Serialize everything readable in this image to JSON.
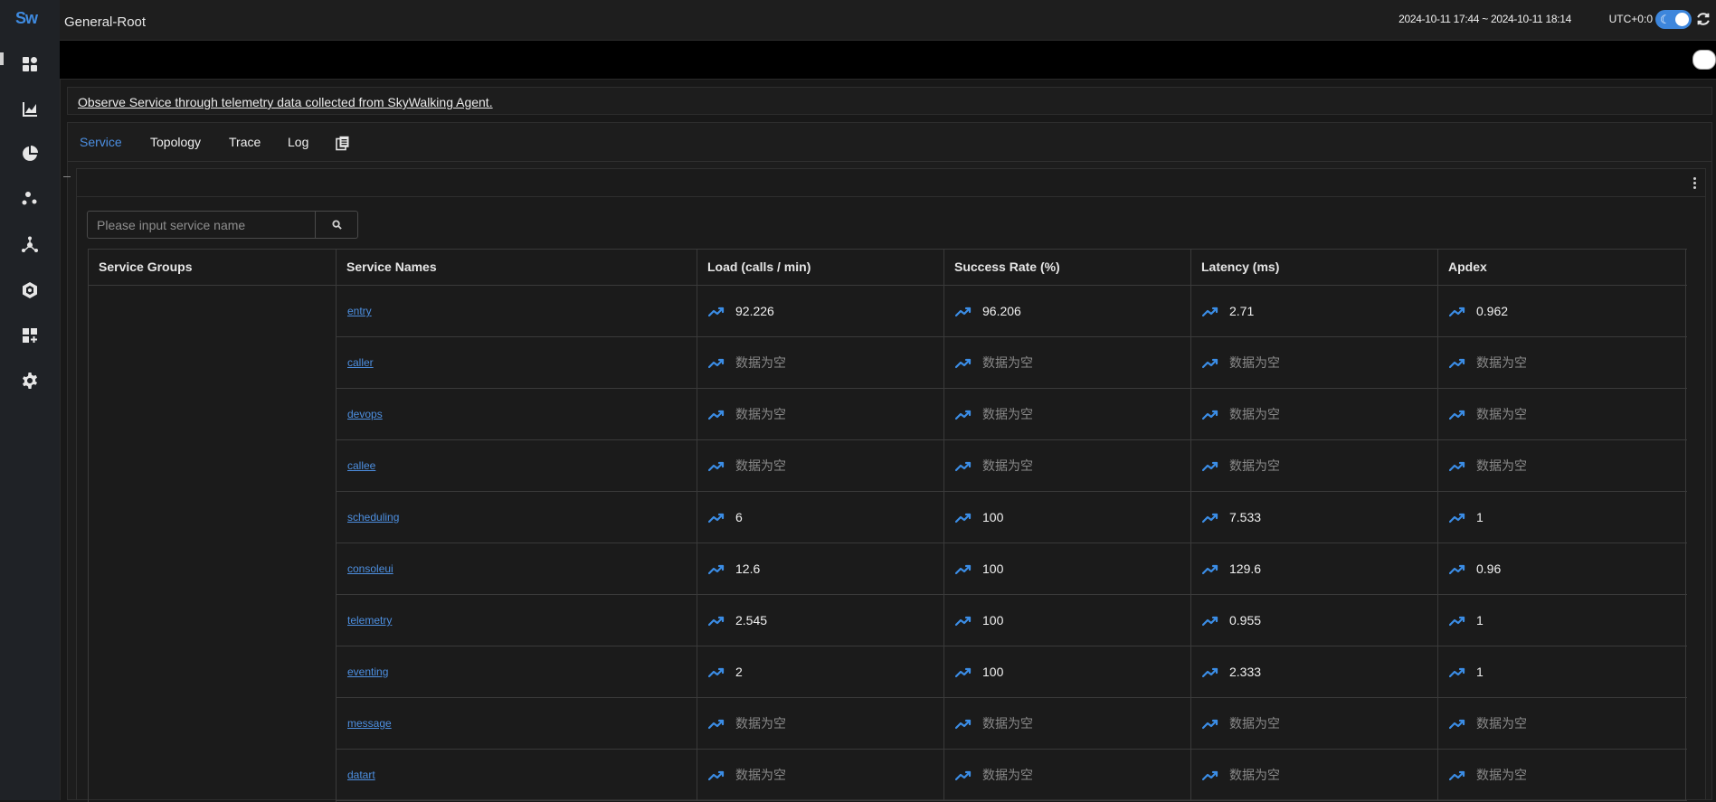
{
  "app": {
    "logo": "Sw",
    "page_title": "General-Root"
  },
  "topbar": {
    "time_range": "2024-10-11 17:44 ~ 2024-10-11 18:14",
    "timezone": "UTC+0:0",
    "theme_icon": "moon-icon",
    "refresh_icon": "refresh-icon"
  },
  "sidebar": {
    "items": [
      {
        "icon": "dashboard-grid-icon"
      },
      {
        "icon": "chart-icon"
      },
      {
        "icon": "pie-chart-icon"
      },
      {
        "icon": "dots-cluster-icon"
      },
      {
        "icon": "topology-icon"
      },
      {
        "icon": "hexagon-icon"
      },
      {
        "icon": "add-widget-icon"
      },
      {
        "icon": "settings-gear-icon"
      }
    ]
  },
  "description": "Observe Service through telemetry data collected from SkyWalking Agent.",
  "tabs": [
    {
      "label": "Service",
      "active": true
    },
    {
      "label": "Topology",
      "active": false
    },
    {
      "label": "Trace",
      "active": false
    },
    {
      "label": "Log",
      "active": false
    }
  ],
  "search": {
    "placeholder": "Please input service name"
  },
  "table": {
    "headers": [
      "Service Groups",
      "Service Names",
      "Load (calls / min)",
      "Success Rate (%)",
      "Latency (ms)",
      "Apdex"
    ],
    "empty_text": "数据为空",
    "rows": [
      {
        "name": "entry",
        "load": "92.226",
        "success": "96.206",
        "latency": "2.71",
        "apdex": "0.962"
      },
      {
        "name": "caller",
        "load": "数据为空",
        "success": "数据为空",
        "latency": "数据为空",
        "apdex": "数据为空"
      },
      {
        "name": "devops",
        "load": "数据为空",
        "success": "数据为空",
        "latency": "数据为空",
        "apdex": "数据为空"
      },
      {
        "name": "callee",
        "load": "数据为空",
        "success": "数据为空",
        "latency": "数据为空",
        "apdex": "数据为空"
      },
      {
        "name": "scheduling",
        "load": "6",
        "success": "100",
        "latency": "7.533",
        "apdex": "1"
      },
      {
        "name": "consoleui",
        "load": "12.6",
        "success": "100",
        "latency": "129.6",
        "apdex": "0.96"
      },
      {
        "name": "telemetry",
        "load": "2.545",
        "success": "100",
        "latency": "0.955",
        "apdex": "1"
      },
      {
        "name": "eventing",
        "load": "2",
        "success": "100",
        "latency": "2.333",
        "apdex": "1"
      },
      {
        "name": "message",
        "load": "数据为空",
        "success": "数据为空",
        "latency": "数据为空",
        "apdex": "数据为空"
      },
      {
        "name": "datart",
        "load": "数据为空",
        "success": "数据为空",
        "latency": "数据为空",
        "apdex": "数据为空"
      }
    ]
  }
}
